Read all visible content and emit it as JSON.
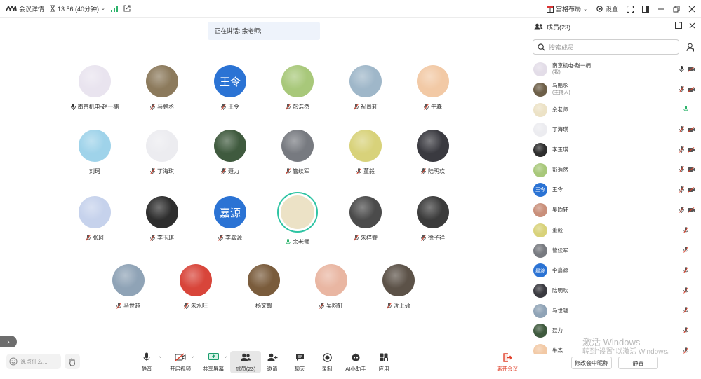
{
  "topbar": {
    "meeting_details": "会议详情",
    "time": "13:56 (40分钟)",
    "layout_label": "宫格布局",
    "settings_label": "设置"
  },
  "stage": {
    "speaking_text": "正在讲话: 余老师;",
    "tiles": [
      {
        "name": "南京机电-赵一楠",
        "mic": "on",
        "avatar": "img",
        "color": "#e9e4ef"
      },
      {
        "name": "马鹏丞",
        "mic": "muted",
        "avatar": "img",
        "color": "#8c7a5c"
      },
      {
        "name": "王令",
        "mic": "muted",
        "avatar": "text",
        "avatar_text": "王令"
      },
      {
        "name": "彭浩然",
        "mic": "muted",
        "avatar": "img",
        "color": "#a8c87a"
      },
      {
        "name": "祝尚轩",
        "mic": "muted",
        "avatar": "img",
        "color": "#9fb7c9"
      },
      {
        "name": "牛森",
        "mic": "muted",
        "avatar": "img",
        "color": "#f2c9a5"
      },
      {
        "name": "刘珂",
        "mic": "none",
        "avatar": "img",
        "color": "#9fd3ea"
      },
      {
        "name": "丁海琪",
        "mic": "muted",
        "avatar": "img",
        "color": "#ececf0"
      },
      {
        "name": "聂力",
        "mic": "muted",
        "avatar": "img",
        "color": "#3f5a3e"
      },
      {
        "name": "管续军",
        "mic": "muted",
        "avatar": "img",
        "color": "#777a80"
      },
      {
        "name": "董毅",
        "mic": "muted",
        "avatar": "img",
        "color": "#d8d27a"
      },
      {
        "name": "陆明欢",
        "mic": "muted",
        "avatar": "img",
        "color": "#3a3a40"
      },
      {
        "name": "张珂",
        "mic": "muted",
        "avatar": "img",
        "color": "#c6d2ec"
      },
      {
        "name": "李玉琪",
        "mic": "muted",
        "avatar": "img",
        "color": "#2e2e2e"
      },
      {
        "name": "李嘉源",
        "mic": "muted",
        "avatar": "text",
        "avatar_text": "嘉源"
      },
      {
        "name": "余老师",
        "mic": "on",
        "avatar": "speaker"
      },
      {
        "name": "朱梓睿",
        "mic": "muted",
        "avatar": "img",
        "color": "#4b4b4b"
      },
      {
        "name": "徐子祥",
        "mic": "muted",
        "avatar": "img",
        "color": "#3b3b3b"
      },
      {
        "name": "马世越",
        "mic": "muted",
        "avatar": "img",
        "color": "#8fa3b6"
      },
      {
        "name": "朱水旺",
        "mic": "muted",
        "avatar": "img",
        "color": "#d8453a"
      },
      {
        "name": "杨文翰",
        "mic": "none",
        "avatar": "img",
        "color": "#7a5c3c"
      },
      {
        "name": "吴昀轩",
        "mic": "muted",
        "avatar": "img",
        "color": "#e9b6a2"
      },
      {
        "name": "沈上硕",
        "mic": "muted",
        "avatar": "img",
        "color": "#5c5248"
      }
    ]
  },
  "toolbar": {
    "chat_placeholder": "说点什么...",
    "mute": "静音",
    "video": "开启视频",
    "share": "共享屏幕",
    "members": "成员(23)",
    "invite": "邀请",
    "chat": "聊天",
    "record": "录制",
    "ai": "AI小助手",
    "apps": "应用",
    "leave": "离开会议"
  },
  "panel": {
    "title": "成员(23)",
    "search_placeholder": "搜索成员",
    "members": [
      {
        "name": "南京机电-赵一楠",
        "role": "(我)",
        "mic": "on",
        "cam": "off",
        "avatar": "img",
        "color": "#e3dde8"
      },
      {
        "name": "马鹏丞",
        "role": "(主持人)",
        "mic": "muted",
        "cam": "off",
        "avatar": "img",
        "color": "#6d5f48"
      },
      {
        "name": "余老师",
        "role": "",
        "mic": "active",
        "cam": "none",
        "avatar": "img",
        "color": "#ece2c6"
      },
      {
        "name": "丁海琪",
        "role": "",
        "mic": "muted",
        "cam": "off",
        "avatar": "img",
        "color": "#ececf0"
      },
      {
        "name": "李玉琪",
        "role": "",
        "mic": "muted",
        "cam": "off",
        "avatar": "img",
        "color": "#2e2e2e"
      },
      {
        "name": "彭浩然",
        "role": "",
        "mic": "muted",
        "cam": "off",
        "avatar": "img",
        "color": "#a8c87a"
      },
      {
        "name": "王令",
        "role": "",
        "mic": "muted",
        "cam": "off",
        "avatar": "text",
        "avatar_text": "王令"
      },
      {
        "name": "吴昀轩",
        "role": "",
        "mic": "muted",
        "cam": "off",
        "avatar": "img",
        "color": "#c98f7a"
      },
      {
        "name": "董毅",
        "role": "",
        "mic": "muted",
        "cam": "none",
        "avatar": "img",
        "color": "#d8d27a"
      },
      {
        "name": "管续军",
        "role": "",
        "mic": "muted",
        "cam": "none",
        "avatar": "img",
        "color": "#777a80"
      },
      {
        "name": "李嘉源",
        "role": "",
        "mic": "muted",
        "cam": "none",
        "avatar": "text",
        "avatar_text": "嘉源"
      },
      {
        "name": "陆明欢",
        "role": "",
        "mic": "muted",
        "cam": "none",
        "avatar": "img",
        "color": "#3a3a40"
      },
      {
        "name": "马世越",
        "role": "",
        "mic": "muted",
        "cam": "none",
        "avatar": "img",
        "color": "#8fa3b6"
      },
      {
        "name": "聂力",
        "role": "",
        "mic": "muted",
        "cam": "none",
        "avatar": "img",
        "color": "#3f5a3e"
      },
      {
        "name": "牛森",
        "role": "",
        "mic": "muted",
        "cam": "none",
        "avatar": "img",
        "color": "#f2c9a5"
      }
    ],
    "rename_button": "修改会中昵称",
    "mute_button": "静音"
  },
  "watermark": {
    "line1": "激活 Windows",
    "line2": "转到\"设置\"以激活 Windows。"
  }
}
